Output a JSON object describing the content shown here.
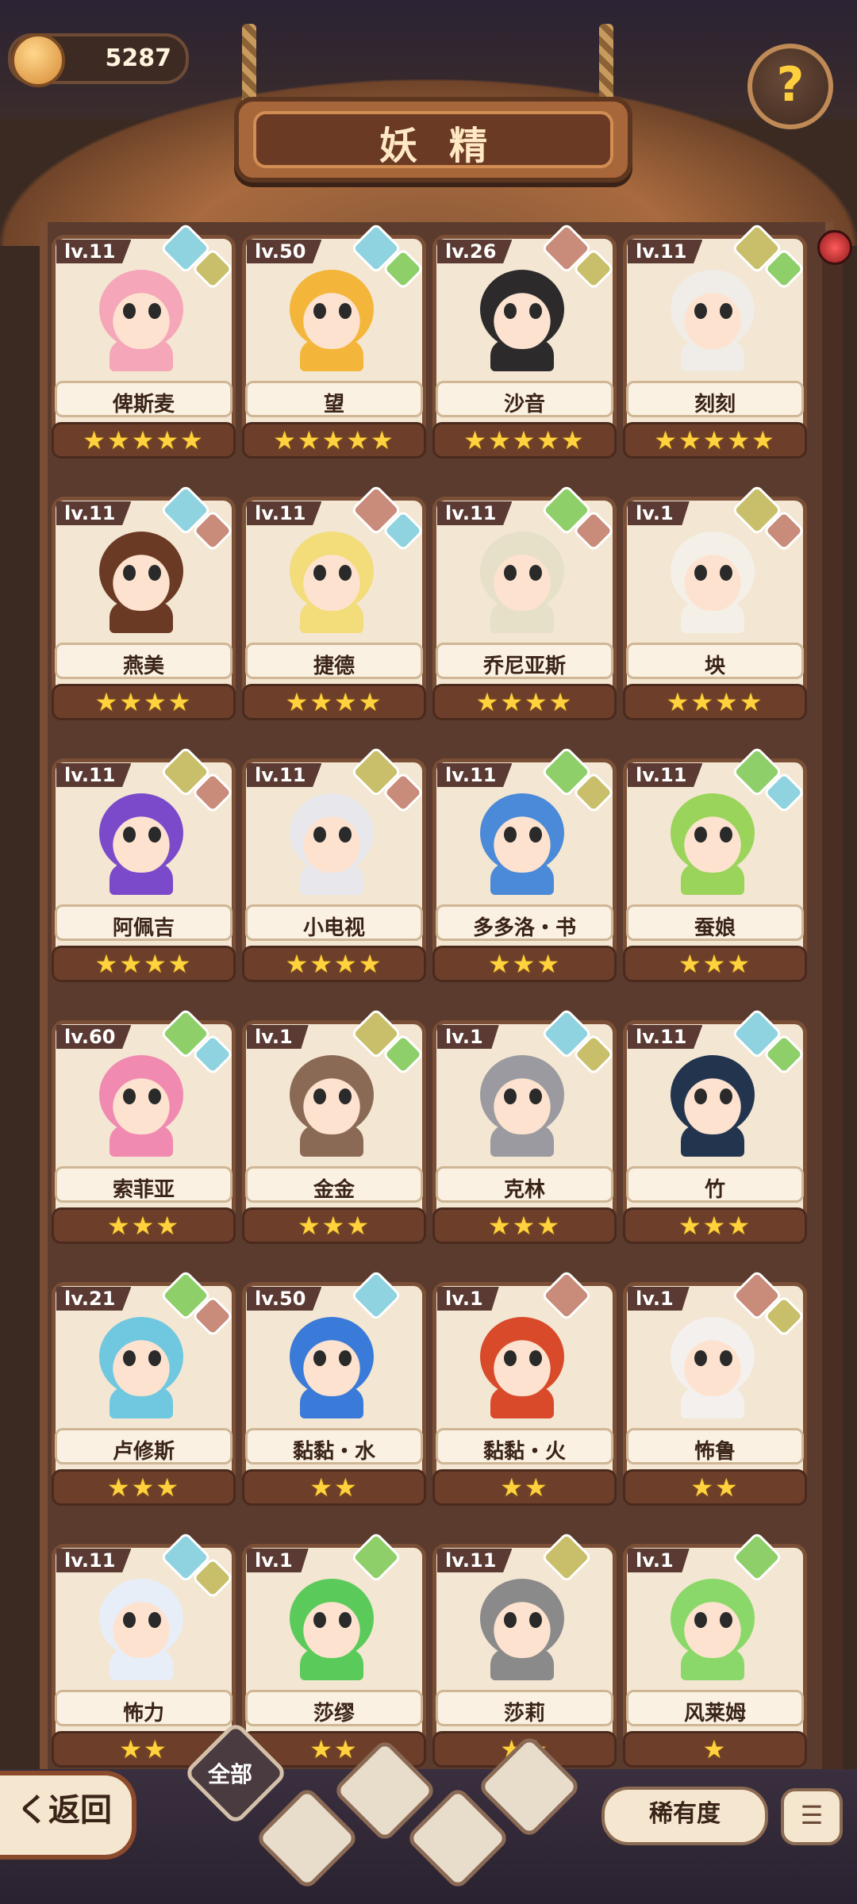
{
  "header": {
    "currency_value": "5287",
    "title": "妖精",
    "help_symbol": "?",
    "currency_icon": "crown-coin-icon",
    "help_icon": "question-sprout-icon"
  },
  "cards": [
    {
      "level": "lv.11",
      "name": "俾斯麦",
      "stars": "★★★★★",
      "hair": "#f5a6b8",
      "e1": "#8fd3e0",
      "e2": "#c9bf6a"
    },
    {
      "level": "lv.50",
      "name": "望",
      "stars": "★★★★★",
      "hair": "#f4b63a",
      "e1": "#8fd3e0",
      "e2": "#8fcf6a"
    },
    {
      "level": "lv.26",
      "name": "沙音",
      "stars": "★★★★★",
      "hair": "#2c2a2a",
      "e1": "#c98b7a",
      "e2": "#c9bf6a"
    },
    {
      "level": "lv.11",
      "name": "刻刻",
      "stars": "★★★★★",
      "hair": "#f0ece8",
      "e1": "#c9bf6a",
      "e2": "#8fcf6a"
    },
    {
      "level": "lv.11",
      "name": "燕美",
      "stars": "★★★★",
      "hair": "#6b3a24",
      "e1": "#8fd3e0",
      "e2": "#c98b7a"
    },
    {
      "level": "lv.11",
      "name": "捷德",
      "stars": "★★★★",
      "hair": "#f3dc7a",
      "e1": "#c98b7a",
      "e2": "#8fd3e0"
    },
    {
      "level": "lv.11",
      "name": "乔尼亚斯",
      "stars": "★★★★",
      "hair": "#e6e0c8",
      "e1": "#8fcf6a",
      "e2": "#c98b7a"
    },
    {
      "level": "lv.1",
      "name": "坱",
      "stars": "★★★★",
      "hair": "#f4f0e8",
      "e1": "#c9bf6a",
      "e2": "#c98b7a"
    },
    {
      "level": "lv.11",
      "name": "阿佩吉",
      "stars": "★★★★",
      "hair": "#7a4acb",
      "e1": "#c9bf6a",
      "e2": "#c98b7a"
    },
    {
      "level": "lv.11",
      "name": "小电视",
      "stars": "★★★★",
      "hair": "#e8e8ec",
      "e1": "#c9bf6a",
      "e2": "#c98b7a"
    },
    {
      "level": "lv.11",
      "name": "多多洛・书",
      "stars": "★★★",
      "hair": "#4a8ad8",
      "e1": "#8fcf6a",
      "e2": "#c9bf6a"
    },
    {
      "level": "lv.11",
      "name": "蚕娘",
      "stars": "★★★",
      "hair": "#9ad45a",
      "e1": "#8fcf6a",
      "e2": "#8fd3e0"
    },
    {
      "level": "lv.60",
      "name": "索菲亚",
      "stars": "★★★",
      "hair": "#f08ab0",
      "e1": "#8fcf6a",
      "e2": "#8fd3e0"
    },
    {
      "level": "lv.1",
      "name": "金金",
      "stars": "★★★",
      "hair": "#8a6a55",
      "e1": "#c9bf6a",
      "e2": "#8fcf6a"
    },
    {
      "level": "lv.1",
      "name": "克林",
      "stars": "★★★",
      "hair": "#9a9aa0",
      "e1": "#8fd3e0",
      "e2": "#c9bf6a"
    },
    {
      "level": "lv.11",
      "name": "竹",
      "stars": "★★★",
      "hair": "#23344f",
      "e1": "#8fd3e0",
      "e2": "#8fcf6a"
    },
    {
      "level": "lv.21",
      "name": "卢修斯",
      "stars": "★★★",
      "hair": "#6fc8e0",
      "e1": "#8fcf6a",
      "e2": "#c98b7a"
    },
    {
      "level": "lv.50",
      "name": "黏黏・水",
      "stars": "★★",
      "hair": "#3a7ad8",
      "e1": "#8fd3e0",
      "e2": ""
    },
    {
      "level": "lv.1",
      "name": "黏黏・火",
      "stars": "★★",
      "hair": "#d84a2a",
      "e1": "#c98b7a",
      "e2": ""
    },
    {
      "level": "lv.1",
      "name": "怖鲁",
      "stars": "★★",
      "hair": "#f4f0ee",
      "e1": "#c98b7a",
      "e2": "#c9bf6a"
    },
    {
      "level": "lv.11",
      "name": "怖力",
      "stars": "★★",
      "hair": "#e8eef8",
      "e1": "#8fd3e0",
      "e2": "#c9bf6a"
    },
    {
      "level": "lv.1",
      "name": "莎缪",
      "stars": "★★",
      "hair": "#5acb5a",
      "e1": "#8fcf6a",
      "e2": ""
    },
    {
      "level": "lv.11",
      "name": "莎莉",
      "stars": "★★",
      "hair": "#8a8a8a",
      "e1": "#c9bf6a",
      "e2": ""
    },
    {
      "level": "lv.1",
      "name": "风莱姆",
      "stars": "★",
      "hair": "#8ad86a",
      "e1": "#8fcf6a",
      "e2": ""
    }
  ],
  "footer": {
    "back_label": "く返回",
    "all_tab_label": "全部",
    "rarity_label": "稀有度",
    "sort_icon": "sort-list-icon",
    "element_tabs": [
      "sprout-icon",
      "water-drop-icon",
      "earth-mountain-icon",
      "snow-mountain-icon"
    ]
  }
}
